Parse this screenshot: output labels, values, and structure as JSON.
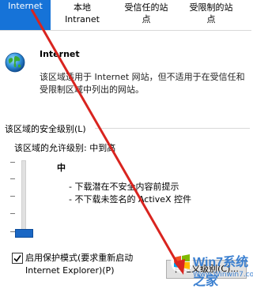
{
  "tabs": [
    {
      "line1": "Internet",
      "line2": ""
    },
    {
      "line1": "本地",
      "line2": "Intranet"
    },
    {
      "line1": "受信任的站",
      "line2": "点"
    },
    {
      "line1": "受限制的站",
      "line2": "点"
    }
  ],
  "zone": {
    "title": "Internet",
    "description": "该区域适用于 Internet 网站，但不适用于在受信任和受限制区域中列出的网站。"
  },
  "security": {
    "group_label": "该区域的安全级别(L)",
    "allowed_label": "该区域的允许级别: 中到高",
    "level_name": "中",
    "bullets": [
      "- 下载潜在不安全内容前提示",
      "- 不下载未签名的 ActiveX 控件"
    ]
  },
  "protected_mode": {
    "label_line1": "启用保护模式(要求重新启动",
    "label_line2": "Internet Explorer)(P)",
    "checked": true
  },
  "custom_level_button": "自定义级别(C)...",
  "watermark": {
    "brand": "Win7系统之家",
    "url": "Www.Winwin7.com"
  },
  "colors": {
    "accent": "#1673d8",
    "annotation": "#d9241f",
    "slider_thumb": "#1a67c4"
  }
}
